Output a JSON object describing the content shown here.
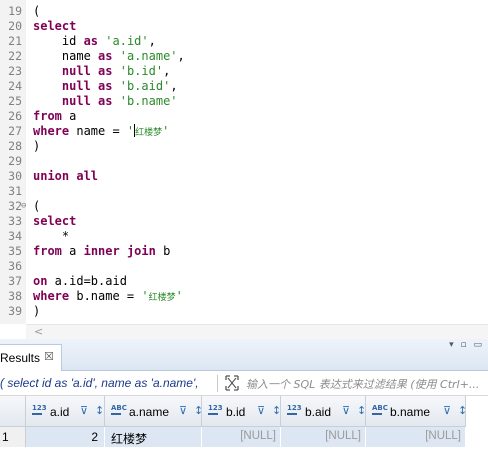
{
  "editor": {
    "lines": [
      {
        "n": "19",
        "html": "("
      },
      {
        "n": "20",
        "html": "<span class='kw'>select</span>"
      },
      {
        "n": "21",
        "html": "    id <span class='kw'>as</span> <span class='str'>'a.id'</span>,"
      },
      {
        "n": "22",
        "html": "    name <span class='kw'>as</span> <span class='str'>'a.name'</span>,"
      },
      {
        "n": "23",
        "html": "    <span class='kw'>null</span> <span class='kw'>as</span> <span class='str'>'b.id'</span>,"
      },
      {
        "n": "24",
        "html": "    <span class='kw'>null</span> <span class='kw'>as</span> <span class='str'>'b.aid'</span>,"
      },
      {
        "n": "25",
        "html": "    <span class='kw'>null</span> <span class='kw'>as</span> <span class='str'>'b.name'</span>"
      },
      {
        "n": "26",
        "html": "<span class='kw'>from</span> a"
      },
      {
        "n": "27",
        "html": "<span class='kw'>where</span> name = <span class='str'>'</span><span class='caret'></span><span class='cjk'>红楼梦</span><span class='str'>'</span>"
      },
      {
        "n": "28",
        "html": ")"
      },
      {
        "n": "29",
        "html": ""
      },
      {
        "n": "30",
        "html": "<span class='kw'>union</span> <span class='kw'>all</span>"
      },
      {
        "n": "31",
        "html": ""
      },
      {
        "n": "32",
        "html": "(",
        "fold": "⊖"
      },
      {
        "n": "33",
        "html": "<span class='kw'>select</span>"
      },
      {
        "n": "34",
        "html": "    *"
      },
      {
        "n": "35",
        "html": "<span class='kw'>from</span> a <span class='kw'>inner</span> <span class='kw'>join</span> b"
      },
      {
        "n": "36",
        "html": ""
      },
      {
        "n": "37",
        "html": "<span class='kw'>on</span> a.id=b.aid"
      },
      {
        "n": "38",
        "html": "<span class='kw'>where</span> b.name = <span class='str'>'</span><span class='cjk'>红楼梦</span><span class='str'>'</span>"
      },
      {
        "n": "39",
        "html": ")"
      }
    ],
    "scroll_left_arrow": "<"
  },
  "results": {
    "tab_label": "Results",
    "tab_close": "☒",
    "view_controls": "▾ ▫ ▭",
    "query_text": "( select id as 'a.id', name as 'a.name',",
    "filter_placeholder": "输入一个 SQL 表达式来过滤结果 (使用 Ctrl+...",
    "columns": [
      {
        "type_icon": "123",
        "name": "a.id"
      },
      {
        "type_icon": "ABC",
        "name": "a.name"
      },
      {
        "type_icon": "123",
        "name": "b.id"
      },
      {
        "type_icon": "123",
        "name": "b.aid"
      },
      {
        "type_icon": "ABC",
        "name": "b.name"
      }
    ],
    "rows": [
      {
        "row_num": "1",
        "cells": [
          "2",
          "红楼梦",
          "[NULL]",
          "[NULL]",
          "[NULL]"
        ]
      }
    ]
  },
  "colors": {
    "keyword": "#7f0055",
    "string": "#2a8a2a",
    "selected_row": "#dde7f3",
    "null_text": "#9a9a9a"
  }
}
